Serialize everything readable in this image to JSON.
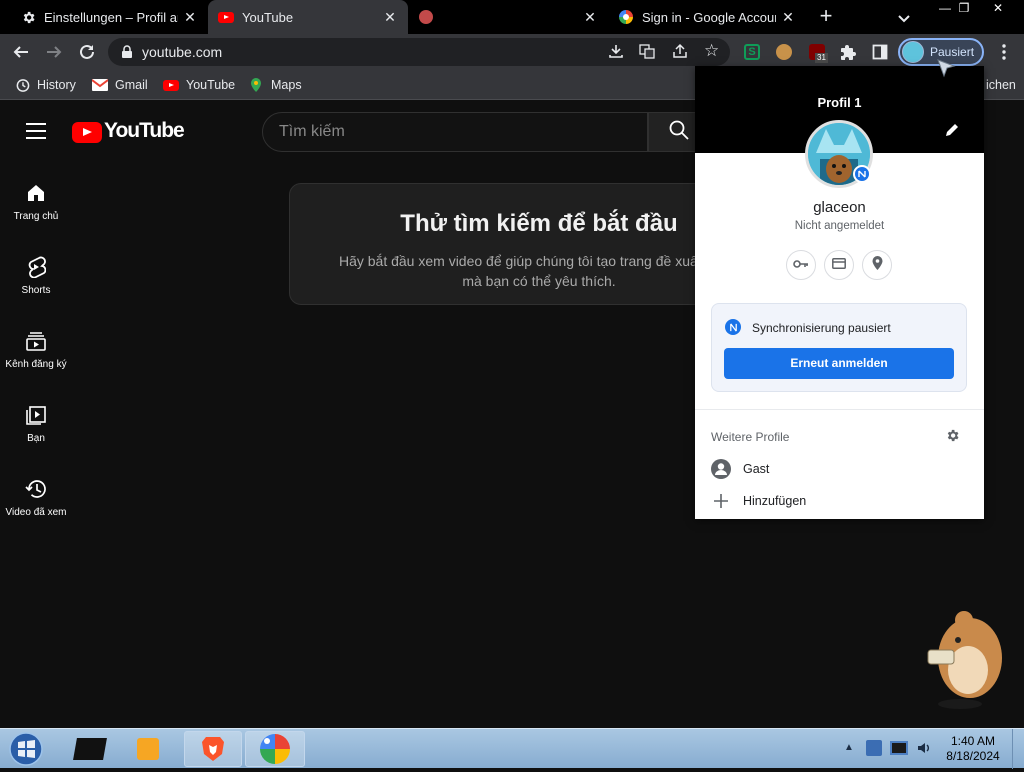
{
  "browser": {
    "tabs": [
      {
        "title": "Einstellungen – Profil anpassen",
        "icon": "gear-icon",
        "active": false
      },
      {
        "title": "YouTube",
        "icon": "youtube-icon",
        "active": true
      },
      {
        "title": "",
        "icon": "tab-icon",
        "active": false
      },
      {
        "title": "Sign in - Google Accounts",
        "icon": "google-icon",
        "active": false
      }
    ],
    "new_tab": "+",
    "address": "youtube.com",
    "profile_chip_label": "Pausiert",
    "extension_badge": "31",
    "bookmarks": [
      {
        "label": "History",
        "icon": "history-icon"
      },
      {
        "label": "Gmail",
        "icon": "gmail-icon"
      },
      {
        "label": "YouTube",
        "icon": "youtube-icon"
      },
      {
        "label": "Maps",
        "icon": "maps-icon"
      }
    ],
    "bookmarks_overflow": "ichen"
  },
  "youtube": {
    "logo_text": "YouTube",
    "search_placeholder": "Tìm kiếm",
    "nav": [
      {
        "label": "Trang chủ",
        "icon": "home-icon"
      },
      {
        "label": "Shorts",
        "icon": "shorts-icon"
      },
      {
        "label": "Kênh đăng ký",
        "icon": "subscriptions-icon"
      },
      {
        "label": "Bạn",
        "icon": "you-icon"
      },
      {
        "label": "Video đã xem",
        "icon": "history-icon"
      }
    ],
    "empty_title": "Thử tìm kiếm để bắt đầu",
    "empty_text": "Hãy bắt đầu xem video để giúp chúng tôi tạo trang đề xuất video mà bạn có thể yêu thích."
  },
  "profile_popup": {
    "title": "Profil 1",
    "name": "glaceon",
    "status": "Nicht angemeldet",
    "sync_message": "Synchronisierung pausiert",
    "signin_button": "Erneut anmelden",
    "other_profiles_label": "Weitere Profile",
    "guest": "Gast",
    "add": "Hinzufügen"
  },
  "taskbar": {
    "time": "1:40 AM",
    "date": "8/18/2024"
  },
  "colors": {
    "yt_background": "#0f0f0f",
    "chrome_toolbar": "#35363a",
    "accent_blue": "#1a73e8",
    "youtube_red": "#ff0000"
  }
}
